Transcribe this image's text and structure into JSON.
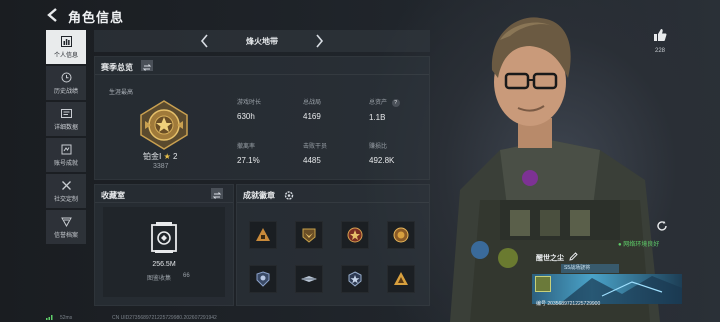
{
  "header": {
    "title": "角色信息"
  },
  "nav": {
    "items": [
      {
        "label": "个人信息",
        "icon": "bar-chart-icon",
        "active": true
      },
      {
        "label": "历史战绩",
        "icon": "history-icon",
        "active": false
      },
      {
        "label": "详细数据",
        "icon": "detail-data-icon",
        "active": false
      },
      {
        "label": "账号成就",
        "icon": "achievement-icon",
        "active": false
      },
      {
        "label": "社交定制",
        "icon": "social-custom-icon",
        "active": false
      },
      {
        "label": "信誉档案",
        "icon": "credit-file-icon",
        "active": false
      }
    ]
  },
  "mode_tab": {
    "title": "烽火地带"
  },
  "season": {
    "title": "赛季总览",
    "rank_caption": "生涯最高",
    "rank_name": "铂金Ⅰ",
    "rank_star": "★",
    "rank_stars": "2",
    "rank_score": "3387",
    "stats": [
      {
        "label": "游戏时长",
        "value": "630h"
      },
      {
        "label": "总战局",
        "value": "4169"
      },
      {
        "label": "总资产",
        "value": "1.1B",
        "help": "?"
      },
      {
        "label": "撤离率",
        "value": "27.1%"
      },
      {
        "label": "击败干员",
        "value": "4485"
      },
      {
        "label": "赚损比",
        "value": "492.8K"
      }
    ]
  },
  "collection": {
    "title": "收藏室",
    "size": "256.5M",
    "label": "图鉴收集",
    "count": "66"
  },
  "achievements": {
    "title": "成就徽章",
    "badges": [
      {
        "icon": "triangle-badge-icon",
        "color": "#c98a3a"
      },
      {
        "icon": "eagle-badge-icon",
        "color": "#c9a24a"
      },
      {
        "icon": "star-medal-icon",
        "color": "#b9533a"
      },
      {
        "icon": "round-medal-icon",
        "color": "#c98a3a"
      },
      {
        "icon": "shield-badge-icon",
        "color": "#8aa0c9"
      },
      {
        "icon": "wing-badge-icon",
        "color": "#b8c4d4"
      },
      {
        "icon": "star-shield-icon",
        "color": "#9ab0cf"
      },
      {
        "icon": "gold-triangle-badge-icon",
        "color": "#d8a03e"
      }
    ]
  },
  "character": {
    "likes": "228",
    "status": "● 网络环境良好",
    "name": "醒世之尘",
    "title_tag": "S5战场骁将",
    "id_line": "编号 2035689721225729900"
  },
  "statusbar": {
    "ping": "52ms",
    "uid": "CN UID2735689721225729980.20260729194​2"
  },
  "colors": {
    "accent": "#e9ebec",
    "status_green": "#5fcf6a",
    "gold": "#e8c04a"
  }
}
